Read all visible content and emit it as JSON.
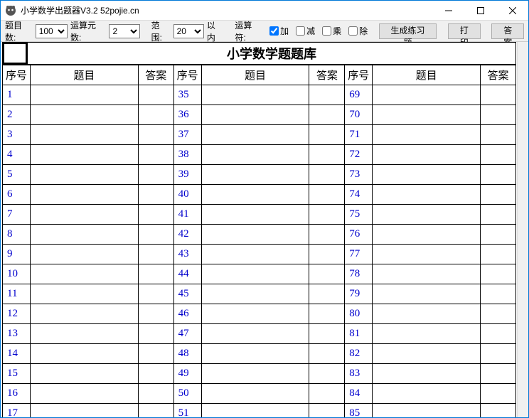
{
  "window": {
    "title": "小学数学出题器V3.2 52pojie.cn"
  },
  "toolbar": {
    "count_label": "题目数:",
    "count_value": "100",
    "operands_label": "运算元数:",
    "operands_value": "2",
    "range_label": "范围:",
    "range_value": "20",
    "range_suffix": "以内",
    "operator_label": "运算符:",
    "add_label": "加",
    "add_checked": true,
    "sub_label": "减",
    "sub_checked": false,
    "mul_label": "乘",
    "mul_checked": false,
    "div_label": "除",
    "div_checked": false,
    "generate_label": "生成练习题",
    "print_label": "打印",
    "answer_label": "答案"
  },
  "grid": {
    "heading": "小学数学题题库",
    "col_idx": "序号",
    "col_q": "题目",
    "col_a": "答案",
    "col1_start": 1,
    "col2_start": 35,
    "col3_start": 69,
    "visible_rows": 17
  }
}
